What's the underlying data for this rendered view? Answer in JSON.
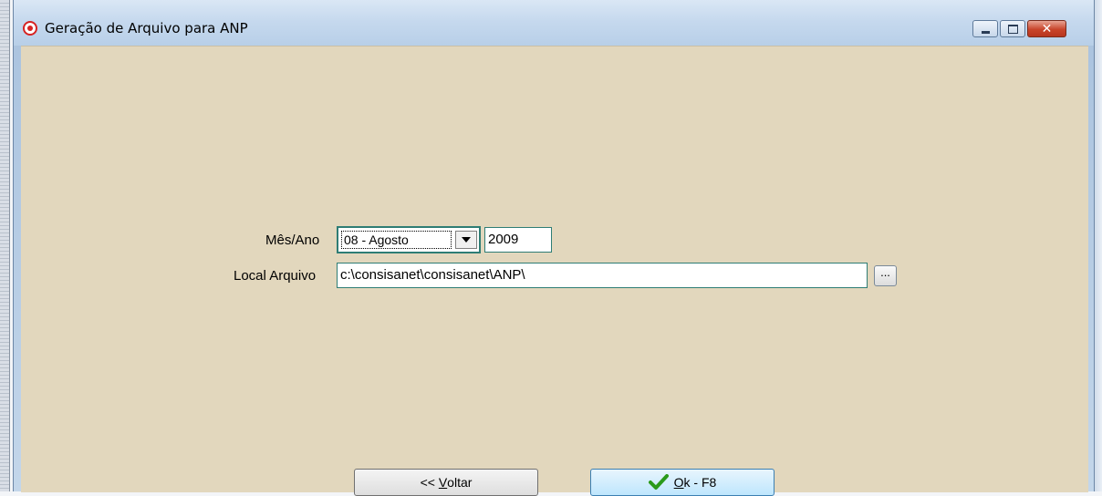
{
  "window": {
    "title": "Geração de Arquivo para ANP",
    "buttons": {
      "minimize": "minimize-icon",
      "maximize": "maximize-icon",
      "close": "close-icon"
    }
  },
  "form": {
    "month_year_label": "Mês/Ano",
    "month_selected": "08 - Agosto",
    "year_value": "2009",
    "file_location_label": "Local Arquivo",
    "file_location_value": "c:\\consisanet\\consisanet\\ANP\\",
    "browse_label": "..."
  },
  "actions": {
    "back": {
      "prefix": "<< ",
      "accel": "V",
      "rest": "oltar"
    },
    "ok": {
      "accel": "O",
      "rest": "k - F8"
    }
  },
  "colors": {
    "client_bg": "#e2d7bd",
    "focus_border": "#2e7d75",
    "check_green": "#2a9a1a"
  }
}
